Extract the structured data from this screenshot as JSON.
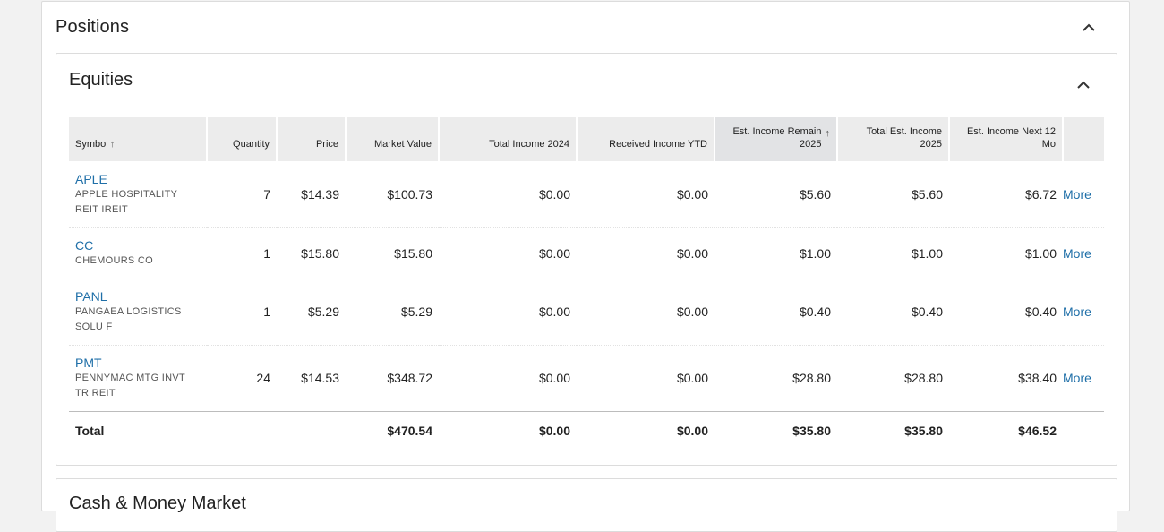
{
  "positions": {
    "title": "Positions"
  },
  "equities": {
    "title": "Equities",
    "headers": {
      "symbol": "Symbol",
      "quantity": "Quantity",
      "price": "Price",
      "market_value": "Market Value",
      "total_income_2024": "Total Income 2024",
      "received_income_ytd": "Received Income YTD",
      "est_income_remain_line1": "Est. Income Remain",
      "est_income_remain_line2": "2025",
      "total_est_income_line1": "Total Est. Income",
      "total_est_income_line2": "2025",
      "est_income_next_line1": "Est. Income Next 12",
      "est_income_next_line2": "Mo",
      "sort_arrow": "↑"
    },
    "rows": [
      {
        "symbol": "APLE",
        "desc1": "APPLE HOSPITALITY",
        "desc2": "REIT IREIT",
        "quantity": "7",
        "price": "$14.39",
        "market_value": "$100.73",
        "total_income_2024": "$0.00",
        "received_income_ytd": "$0.00",
        "est_income_remain": "$5.60",
        "total_est_income": "$5.60",
        "est_income_next": "$6.72",
        "more": "More"
      },
      {
        "symbol": "CC",
        "desc1": "CHEMOURS CO",
        "desc2": "",
        "quantity": "1",
        "price": "$15.80",
        "market_value": "$15.80",
        "total_income_2024": "$0.00",
        "received_income_ytd": "$0.00",
        "est_income_remain": "$1.00",
        "total_est_income": "$1.00",
        "est_income_next": "$1.00",
        "more": "More"
      },
      {
        "symbol": "PANL",
        "desc1": "PANGAEA LOGISTICS",
        "desc2": "SOLU F",
        "quantity": "1",
        "price": "$5.29",
        "market_value": "$5.29",
        "total_income_2024": "$0.00",
        "received_income_ytd": "$0.00",
        "est_income_remain": "$0.40",
        "total_est_income": "$0.40",
        "est_income_next": "$0.40",
        "more": "More"
      },
      {
        "symbol": "PMT",
        "desc1": "PENNYMAC MTG INVT",
        "desc2": "TR REIT",
        "quantity": "24",
        "price": "$14.53",
        "market_value": "$348.72",
        "total_income_2024": "$0.00",
        "received_income_ytd": "$0.00",
        "est_income_remain": "$28.80",
        "total_est_income": "$28.80",
        "est_income_next": "$38.40",
        "more": "More"
      }
    ],
    "total": {
      "label": "Total",
      "market_value": "$470.54",
      "total_income_2024": "$0.00",
      "received_income_ytd": "$0.00",
      "est_income_remain": "$35.80",
      "total_est_income": "$35.80",
      "est_income_next": "$46.52"
    }
  },
  "next_section": {
    "title": "Cash & Money Market"
  },
  "icons": {
    "collapse": "chevron-up-icon"
  },
  "colors": {
    "link": "#1f6fa8",
    "header_bg": "#ececec",
    "sorted_header_bg": "#e2e3e5"
  }
}
